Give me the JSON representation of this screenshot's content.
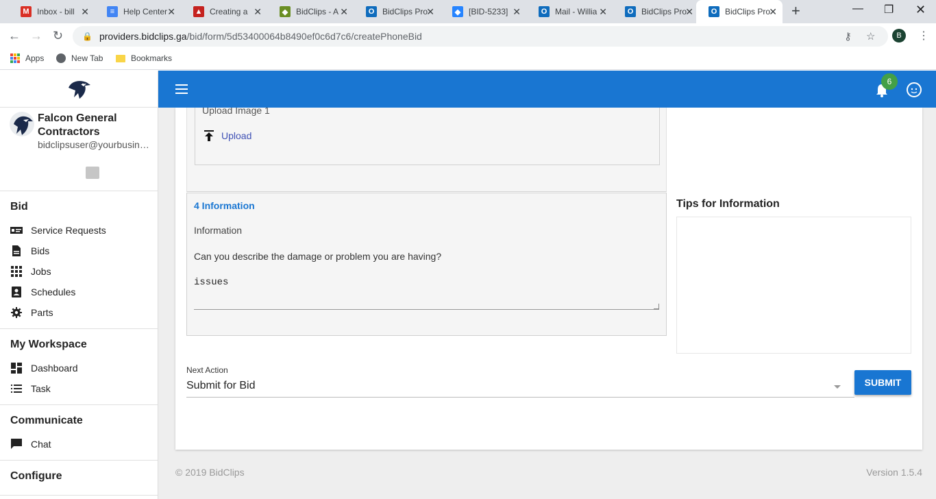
{
  "browser": {
    "tabs": [
      {
        "title": "Inbox - bill",
        "favicon": "gmail-icon",
        "color": "#d93025",
        "glyph": "M"
      },
      {
        "title": "Help Center",
        "favicon": "docs-icon",
        "color": "#4285f4",
        "glyph": "≡"
      },
      {
        "title": "Creating a",
        "favicon": "triangle-icon",
        "color": "#c5221f",
        "glyph": "▲"
      },
      {
        "title": "BidClips - A",
        "favicon": "bidclips-icon",
        "color": "#6a8e23",
        "glyph": "◆"
      },
      {
        "title": "BidClips Pro",
        "favicon": "outlook-icon",
        "color": "#0f6cbd",
        "glyph": "O"
      },
      {
        "title": "[BID-5233]",
        "favicon": "jira-icon",
        "color": "#2684ff",
        "glyph": "◆"
      },
      {
        "title": "Mail - Willia",
        "favicon": "outlook-icon",
        "color": "#0f6cbd",
        "glyph": "O"
      },
      {
        "title": "BidClips Pro",
        "favicon": "outlook-icon",
        "color": "#0f6cbd",
        "glyph": "O"
      },
      {
        "title": "BidClips Pro",
        "favicon": "outlook-icon",
        "color": "#0f6cbd",
        "glyph": "O"
      }
    ],
    "url_host": "providers.bidclips.ga",
    "url_path": "/bid/form/5d53400064b8490ef0c6d7c6/createPhoneBid",
    "profile_initial": "B",
    "bookmarks": [
      "Apps",
      "New Tab",
      "Bookmarks"
    ]
  },
  "sidebar": {
    "company_name": "Falcon General Contractors",
    "email": "bidclipsuser@yourbusiness.com",
    "sections": [
      {
        "heading": "Bid",
        "items": [
          {
            "label": "Service Requests",
            "icon": "card-icon"
          },
          {
            "label": "Bids",
            "icon": "document-icon"
          },
          {
            "label": "Jobs",
            "icon": "grid-icon"
          },
          {
            "label": "Schedules",
            "icon": "contact-icon"
          },
          {
            "label": "Parts",
            "icon": "gear-icon"
          }
        ]
      },
      {
        "heading": "My Workspace",
        "items": [
          {
            "label": "Dashboard",
            "icon": "dashboard-icon"
          },
          {
            "label": "Task",
            "icon": "list-icon"
          }
        ]
      },
      {
        "heading": "Communicate",
        "items": [
          {
            "label": "Chat",
            "icon": "chat-icon"
          }
        ]
      },
      {
        "heading": "Configure",
        "items": []
      }
    ]
  },
  "header": {
    "notification_count": "6",
    "accent": "#1976d2",
    "badge_color": "#43a047"
  },
  "form": {
    "upload_label": "Upload Image 1",
    "upload_button": "Upload",
    "step_title": "4 Information",
    "field_label": "Information",
    "question": "Can you describe the damage or problem you are having?",
    "answer": "issues",
    "tips_title": "Tips for Information",
    "next_action_label": "Next Action",
    "next_action_value": "Submit for Bid",
    "submit_label": "SUBMIT"
  },
  "footer": {
    "copyright": "© 2019 BidClips",
    "version": "Version 1.5.4"
  }
}
